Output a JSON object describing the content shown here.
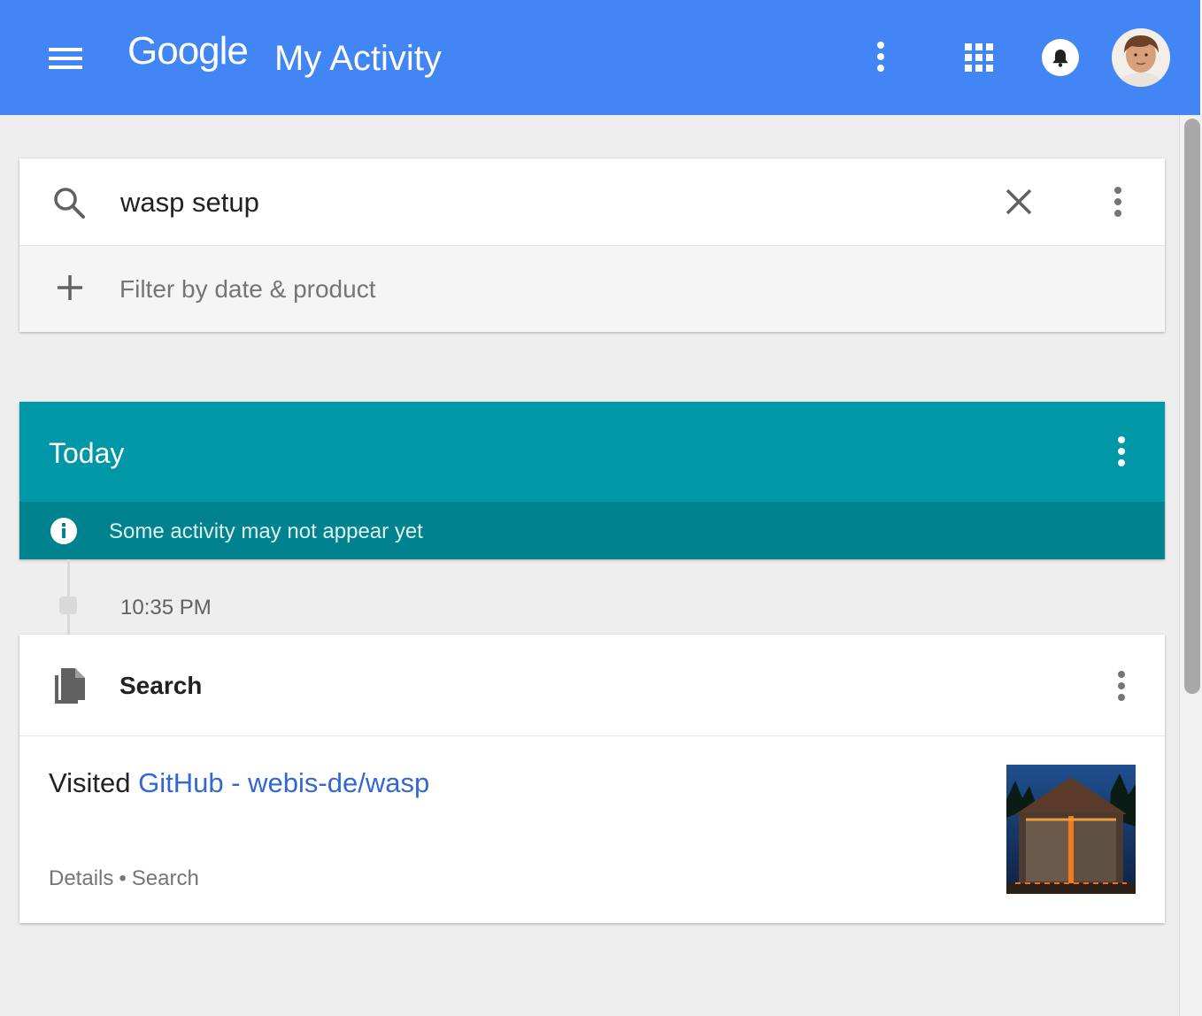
{
  "header": {
    "logo_text": "Google",
    "title": "My Activity",
    "background_color": "#4285f4",
    "icons": [
      "menu-icon",
      "more-vert-icon",
      "apps-icon",
      "notifications-icon",
      "avatar"
    ]
  },
  "search": {
    "query": "wasp setup",
    "filter_label": "Filter by date & product",
    "icons": [
      "search-icon",
      "close-icon",
      "more-vert-icon",
      "plus-icon"
    ]
  },
  "today": {
    "title": "Today",
    "notice": "Some activity may not appear yet",
    "header_color": "#0097a7",
    "notice_color": "#00838f"
  },
  "activity": {
    "time": "10:35 PM",
    "product": "Search",
    "visited_prefix": "Visited",
    "link_text": "GitHub - webis-de/wasp",
    "link_color": "#3367d6",
    "meta_details": "Details",
    "meta_separator": "•",
    "meta_product": "Search"
  }
}
